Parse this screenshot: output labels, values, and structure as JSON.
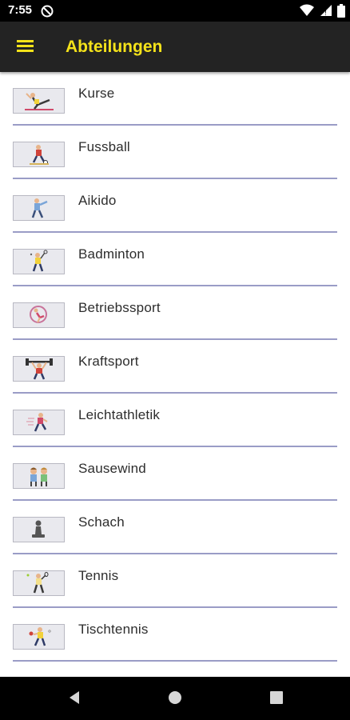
{
  "status_bar": {
    "time": "7:55"
  },
  "app_bar": {
    "title": "Abteilungen",
    "accent_color": "#f4e21a"
  },
  "departments": [
    {
      "label": "Kurse",
      "icon": "gymnastics-icon"
    },
    {
      "label": "Fussball",
      "icon": "soccer-player-icon"
    },
    {
      "label": "Aikido",
      "icon": "martial-arts-icon"
    },
    {
      "label": "Badminton",
      "icon": "badminton-player-icon"
    },
    {
      "label": "Betriebssport",
      "icon": "hoop-gymnast-icon"
    },
    {
      "label": "Kraftsport",
      "icon": "weightlifter-icon"
    },
    {
      "label": "Leichtathletik",
      "icon": "runner-icon"
    },
    {
      "label": "Sausewind",
      "icon": "children-icon"
    },
    {
      "label": "Schach",
      "icon": "chess-pawn-icon"
    },
    {
      "label": "Tennis",
      "icon": "tennis-player-icon"
    },
    {
      "label": "Tischtennis",
      "icon": "table-tennis-player-icon"
    }
  ]
}
